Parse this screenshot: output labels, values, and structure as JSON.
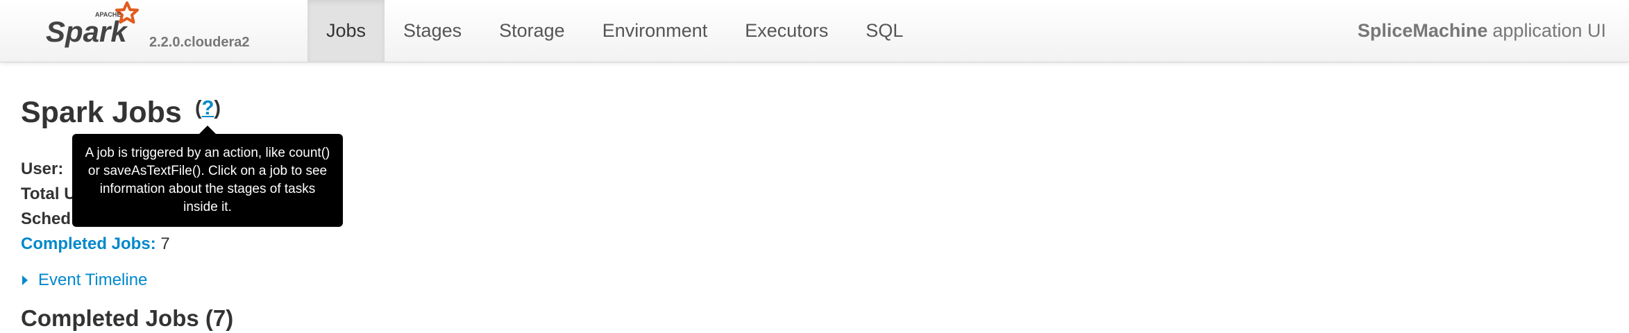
{
  "header": {
    "logo_word": "Spark",
    "logo_superscript": "APACHE",
    "version": "2.2.0.cloudera2",
    "tabs": [
      {
        "label": "Jobs",
        "active": true
      },
      {
        "label": "Stages",
        "active": false
      },
      {
        "label": "Storage",
        "active": false
      },
      {
        "label": "Environment",
        "active": false
      },
      {
        "label": "Executors",
        "active": false
      },
      {
        "label": "SQL",
        "active": false
      }
    ],
    "app_name_bold": "SpliceMachine",
    "app_name_suffix": "application UI"
  },
  "page": {
    "title": "Spark Jobs",
    "help_open": "(",
    "help_q": "?",
    "help_close": ")"
  },
  "summary": {
    "user_label": "User:",
    "total_label": "Total U",
    "scheduling_label": "Sched",
    "completed_label": "Completed Jobs:",
    "completed_value": "7"
  },
  "tooltip": {
    "text": "A job is triggered by an action, like count() or saveAsTextFile(). Click on a job to see information about the stages of tasks inside it."
  },
  "timeline": {
    "label": "Event Timeline"
  },
  "completed_section": {
    "title": "Completed Jobs (7)"
  },
  "colors": {
    "link": "#0088cc",
    "logo_star": "#e25a1c",
    "text": "#333333",
    "tooltip_bg": "#000000"
  },
  "icons": {
    "logo_star": "star-icon",
    "timeline_toggle": "caret-right-icon"
  }
}
